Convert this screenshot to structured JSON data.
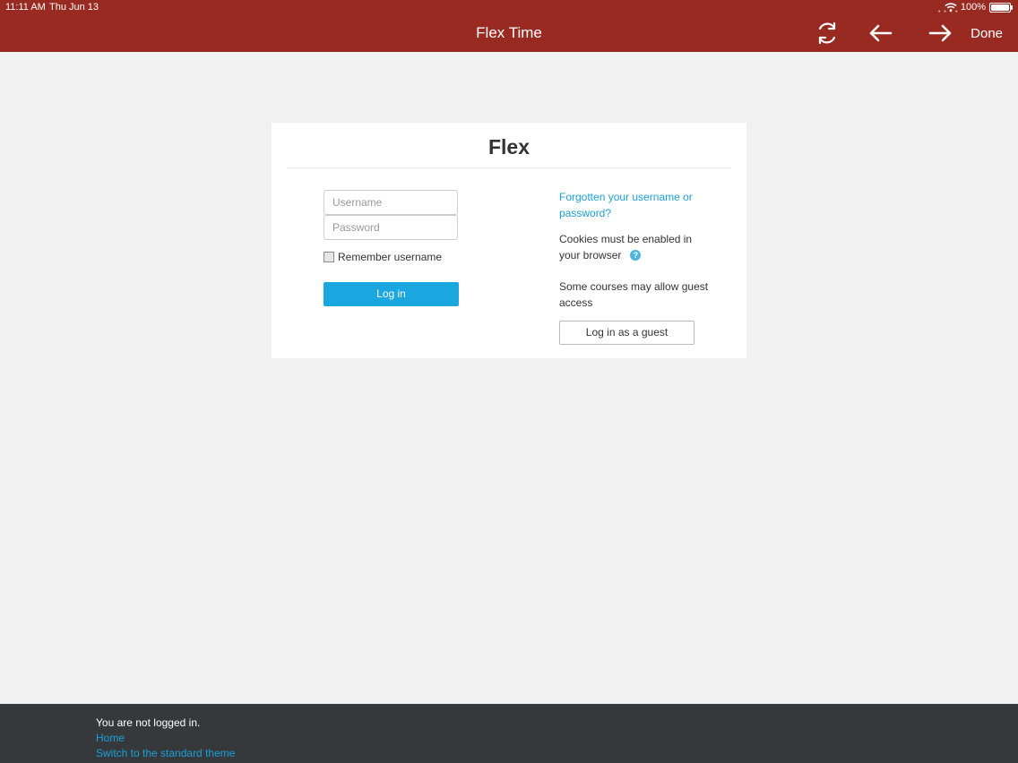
{
  "status_bar": {
    "time": "11:11 AM",
    "date": "Thu Jun 13",
    "battery": "100%"
  },
  "topbar": {
    "title": "Flex Time",
    "done_label": "Done"
  },
  "login": {
    "title": "Flex",
    "username_placeholder": "Username",
    "password_placeholder": "Password",
    "remember_label": "Remember username",
    "login_label": "Log in",
    "forgot_link": "Forgotten your username or password?",
    "cookies_text": "Cookies must be enabled in your browser",
    "guest_text": "Some courses may allow guest access",
    "guest_button": "Log in as a guest"
  },
  "footer": {
    "status": "You are not logged in.",
    "home_link": "Home",
    "theme_link": "Switch to the standard theme"
  }
}
